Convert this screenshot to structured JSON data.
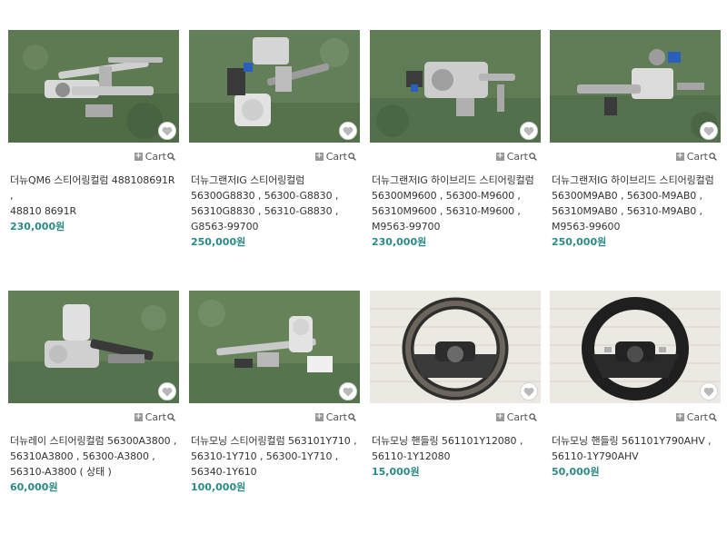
{
  "colors": {
    "price": "#2a8a86",
    "wish_icon": "#b9b9b9"
  },
  "icons": {
    "cart_plus": "plus-icon",
    "search": "magnifier-icon",
    "wish": "heart-icon"
  },
  "products": [
    {
      "cart_label": "Cart",
      "price": "230,000원",
      "title_lines": [
        "더뉴QM6 스티어링컬럼 488108691R ,",
        "48810 8691R"
      ]
    },
    {
      "cart_label": "Cart",
      "price": "250,000원",
      "title_lines": [
        "더뉴그랜저IG 스티어링컬럼",
        "56300G8830 , 56300-G8830 ,",
        "56310G8830 , 56310-G8830 ,",
        "G8563-99700"
      ]
    },
    {
      "cart_label": "Cart",
      "price": "230,000원",
      "title_lines": [
        "더뉴그랜저IG 하이브리드 스티어링컬럼",
        "56300M9600 , 56300-M9600 ,",
        "56310M9600 , 56310-M9600 ,",
        "M9563-99700"
      ]
    },
    {
      "cart_label": "Cart",
      "price": "250,000원",
      "title_lines": [
        "더뉴그랜저IG 하이브리드 스티어링컬럼",
        "56300M9AB0 , 56300-M9AB0 ,",
        "56310M9AB0 , 56310-M9AB0 ,",
        "M9563-99600"
      ]
    },
    {
      "cart_label": "Cart",
      "price": "60,000원",
      "title_lines": [
        "더뉴레이 스티어링컬럼 56300A3800 ,",
        "56310A3800 , 56300-A3800 ,",
        "56310-A3800 ( 상태 )"
      ]
    },
    {
      "cart_label": "Cart",
      "price": "100,000원",
      "title_lines": [
        "더뉴모닝 스티어링컬럼 563101Y710 ,",
        "56310-1Y710 , 56300-1Y710 ,",
        "56340-1Y610"
      ]
    },
    {
      "cart_label": "Cart",
      "price": "15,000원",
      "title_lines": [
        "더뉴모닝 핸들링 561101Y12080 ,",
        "56110-1Y12080"
      ]
    },
    {
      "cart_label": "Cart",
      "price": "50,000원",
      "title_lines": [
        "더뉴모닝 핸들링 561101Y790AHV ,",
        "56110-1Y790AHV"
      ]
    }
  ]
}
